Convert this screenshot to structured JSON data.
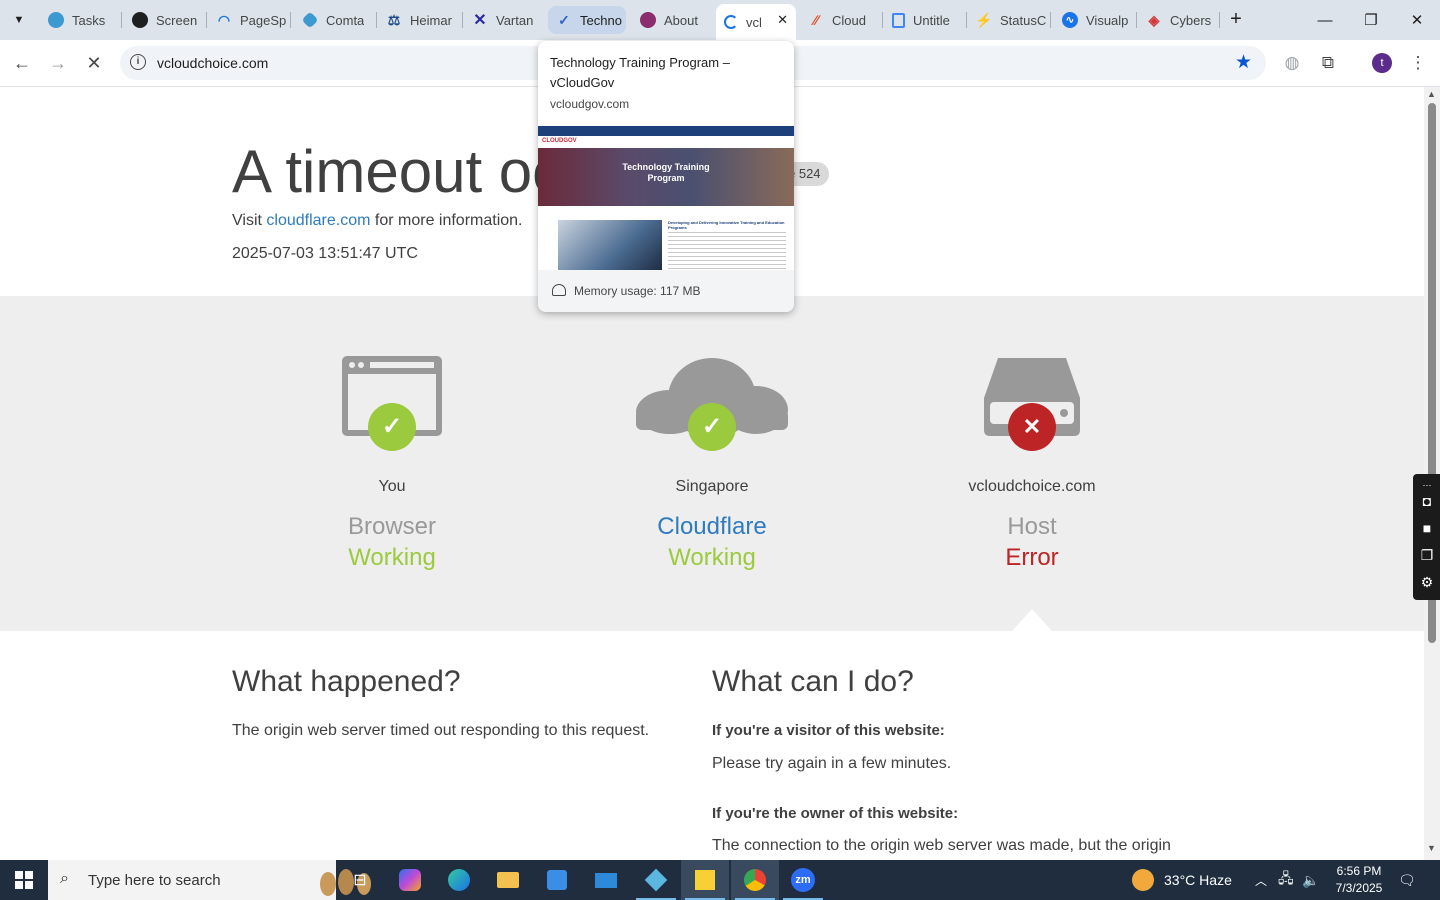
{
  "browser": {
    "tabs": [
      {
        "title": "Tasks",
        "icon": "tasks-icon",
        "color": "#3d9ad1"
      },
      {
        "title": "Screen",
        "icon": "screen-icon",
        "color": "#1f1f1f"
      },
      {
        "title": "PageSp",
        "icon": "pagespeed-icon",
        "color": "#1a73e8"
      },
      {
        "title": "Comta",
        "icon": "comta-icon",
        "color": "#3d9ad1"
      },
      {
        "title": "Heimar",
        "icon": "scales-icon",
        "color": "#1d4e89"
      },
      {
        "title": "Vartan",
        "icon": "vartana-icon",
        "color": "#2a2aa8"
      },
      {
        "title": "Techno",
        "icon": "vcloudgov-icon",
        "color": "#2b64c8"
      },
      {
        "title": "About",
        "icon": "about-icon",
        "color": "#8a2c6e"
      },
      {
        "title": "vcl",
        "icon": "loading-spinner-icon",
        "color": "#1a73e8"
      },
      {
        "title": "Cloud",
        "icon": "cloud-icon",
        "color": "#e8502f"
      },
      {
        "title": "Untitle",
        "icon": "google-docs-icon",
        "color": "#4285f4"
      },
      {
        "title": "StatusC",
        "icon": "statusc-icon",
        "color": "#d6206c"
      },
      {
        "title": "Visualp",
        "icon": "visual-icon",
        "color": "#1a73e8"
      },
      {
        "title": "Cybers",
        "icon": "cybers-icon",
        "color": "#d23a3a"
      }
    ],
    "address": "vcloudchoice.com",
    "profile_initial": "t"
  },
  "hover_card": {
    "title": "Technology Training Program – vCloudGov",
    "domain": "vcloudgov.com",
    "memory": "Memory usage: 117 MB",
    "preview": {
      "brand": "CLOUDGOV",
      "hero_title": "Technology Training Program",
      "article_title": "Developing and Delivering Innovative Training and Education Programs"
    }
  },
  "page": {
    "title": "A timeout oc",
    "error_badge": "e 524",
    "visit_prefix": "Visit",
    "visit_link": "cloudflare.com",
    "visit_suffix": "for more information.",
    "timestamp": "2025-07-03 13:51:47 UTC",
    "nodes": [
      {
        "location": "You",
        "name": "Browser",
        "status": "Working"
      },
      {
        "location": "Singapore",
        "name": "Cloudflare",
        "status": "Working"
      },
      {
        "location": "vcloudchoice.com",
        "name": "Host",
        "status": "Error"
      }
    ],
    "what_happened": {
      "heading": "What happened?",
      "body": "The origin web server timed out responding to this request."
    },
    "what_can_i_do": {
      "heading": "What can I do?",
      "visitor_heading": "If you're a visitor of this website:",
      "visitor_body": "Please try again in a few minutes.",
      "owner_heading": "If you're the owner of this website:",
      "owner_body": "The connection to the origin web server was made, but the origin"
    },
    "colors": {
      "working": "#9bca3e",
      "error": "#bd2426",
      "link": "#2f7bbf"
    }
  },
  "taskbar": {
    "search_placeholder": "Type here to search",
    "weather": "33°C  Haze",
    "time": "6:56 PM",
    "date": "7/3/2025"
  }
}
